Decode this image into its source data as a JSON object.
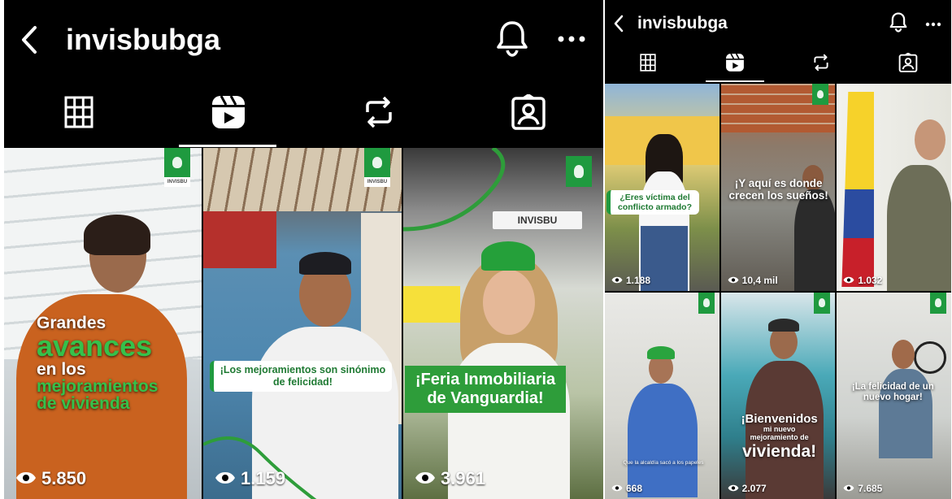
{
  "profile": {
    "username": "invisbubga"
  },
  "colors": {
    "background": "#000000",
    "brand_green": "#1f9a3f",
    "text": "#ffffff"
  },
  "icons": {
    "back": "chevron-left-icon",
    "notifications": "bell-icon",
    "more": "more-horizontal-icon",
    "tab_posts": "grid-icon",
    "tab_reels": "reels-icon",
    "tab_reposts": "repost-icon",
    "tab_tagged": "tagged-person-icon",
    "views": "eye-icon"
  },
  "tabs": [
    {
      "id": "posts",
      "icon": "grid-icon",
      "active": false
    },
    {
      "id": "reels",
      "icon": "reels-icon",
      "active": true
    },
    {
      "id": "reposts",
      "icon": "repost-icon",
      "active": false
    },
    {
      "id": "tagged",
      "icon": "tagged-person-icon",
      "active": false
    }
  ],
  "left_panel": {
    "reels": [
      {
        "views": "5.850",
        "caption_line1": "Grandes",
        "caption_line2": "avances",
        "caption_line3": "en los",
        "caption_line4": "mejoramientos",
        "caption_line5": "de vivienda",
        "logo_text": "INVISBU"
      },
      {
        "views": "1.159",
        "caption": "¡Los mejoramientos son sinónimo de felicidad!"
      },
      {
        "views": "3.961",
        "caption_line1": "¡Feria Inmobiliaria",
        "caption_line2": "de Vanguardia!",
        "logo_text": "INVISBU",
        "sign_text": "INVISBU"
      }
    ]
  },
  "right_panel": {
    "reels": [
      {
        "views": "1.188",
        "caption": "¿Eres víctima del conflicto armado?"
      },
      {
        "views": "10,4 mil",
        "caption": "¡Y aquí es donde crecen los sueños!"
      },
      {
        "views": "1.032"
      },
      {
        "views": "668",
        "subtitle": "Que la alcaldía sacó a los papeles"
      },
      {
        "views": "2.077",
        "caption_line1": "¡Bienvenidos",
        "caption_line2": "mi nuevo",
        "caption_line3": "mejoramiento de",
        "caption_line4": "vivienda!"
      },
      {
        "views": "7.685",
        "caption": "¡La felicidad de un nuevo hogar!"
      }
    ]
  }
}
